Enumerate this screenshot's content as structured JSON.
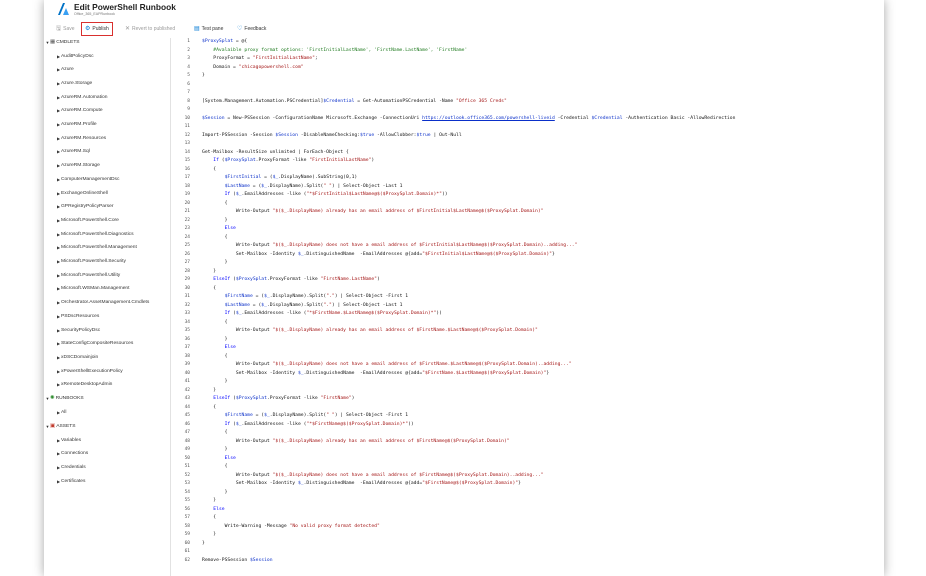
{
  "header": {
    "title": "Edit PowerShell Runbook",
    "subtitle": "Office_365_EAPRunbook"
  },
  "toolbar": {
    "save": "Save",
    "publish": "Publish",
    "revert": "Revert to published",
    "test_pane": "Test pane",
    "feedback": "Feedback"
  },
  "tree": {
    "cmdlets_label": "CMDLETS",
    "modules": [
      "AuditPolicyDsc",
      "Azure",
      "Azure.Storage",
      "AzureRM.Automation",
      "AzureRM.Compute",
      "AzureRM.Profile",
      "AzureRM.Resources",
      "AzureRM.Sql",
      "AzureRM.Storage",
      "ComputerManagementDsc",
      "ExchangeOnlineShell",
      "GPRegistryPolicyParser",
      "Microsoft.PowerShell.Core",
      "Microsoft.PowerShell.Diagnostics",
      "Microsoft.PowerShell.Management",
      "Microsoft.PowerShell.Security",
      "Microsoft.PowerShell.Utility",
      "Microsoft.WSMan.Management",
      "Orchestrator.AssetManagement.Cmdlets",
      "PSDscResources",
      "SecurityPolicyDsc",
      "StateConfigCompositeResources",
      "xDSCDomainjoin",
      "xPowerShellExecutionPolicy",
      "xRemoteDesktopAdmin"
    ],
    "runbooks_label": "RUNBOOKS",
    "runbooks": [
      "All"
    ],
    "assets_label": "ASSETS",
    "assets": [
      "Variables",
      "Connections",
      "Credentials",
      "Certificates"
    ]
  },
  "colors": {
    "accent": "#0078d4",
    "highlight": "#d9302e",
    "variable": "#0a2fc9",
    "string": "#a31515",
    "comment": "#1e7a1e"
  },
  "code_lines": [
    "$ProxySplat = @{",
    "    #Avalaible proxy format options: 'FirstInitialLastName', 'FirstName.LastName', 'FirstName'",
    "    ProxyFormat = \"FirstInitialLastName\";",
    "    Domain = \"chicagopowershell.com\"",
    "}",
    "",
    "",
    "[System.Management.Automation.PSCredential]$Credential = Get-AutomationPSCredential -Name \"Office 365 Creds\"",
    "",
    "$Session = New-PSSession -ConfigurationName Microsoft.Exchange -ConnectionUri https://outlook.office365.com/powershell-liveid -Credential $Credential -Authentication Basic -AllowRedirection",
    "",
    "Import-PSSession -Session $Session -DisableNameChecking:$true -AllowClobber:$true | Out-Null",
    "",
    "Get-Mailbox -ResultSize unlimited | ForEach-Object {",
    "    If ($ProxySplat.ProxyFormat -like \"FirstInitialLastName\")",
    "    {",
    "        $FirstInitial = ($_.DisplayName).SubString(0,1)",
    "        $LastName = ($_.DisplayName).Split(\" \") | Select-Object -Last 1",
    "        If ($_.EmailAddresses -like (\"*$FirstInitial$LastName@$($ProxySplat.Domain)*\"))",
    "        {",
    "            Write-Output \"$($_.DisplayName) already has an email address of $FirstInitial$LastName@$($ProxySplat.Domain)\"",
    "        }",
    "        Else",
    "        {",
    "            Write-Output \"$($_.DisplayName) does not have a email address of $FirstInitial$LastName@$($ProxySplat.Domain)..adding...\"",
    "            Set-Mailbox -Identity $_.DistinguishedName  -EmailAddresses @{add=\"$FirstInitial$LastName@$($ProxySplat.Domain)\"}",
    "        }",
    "    }",
    "    ElseIf ($ProxySplat.ProxyFormat -like \"FirstName.LastName\")",
    "    {",
    "        $FirstName = ($_.DisplayName).Split(\".\") | Select-Object -First 1",
    "        $LastName = ($_.DisplayName).Split(\".\") | Select-Object -Last 1",
    "        If ($_.EmailAddresses -like (\"*$FirstName.$LastName@$($ProxySplat.Domain)*\"))",
    "        {",
    "            Write-Output \"$($_.DisplayName) already has an email address of $FirstName.$LastName@$($ProxySplat.Domain)\"",
    "        }",
    "        Else",
    "        {",
    "            Write-Output \"$($_.DisplayName) does not have a email address of $FirstName.$LastName@$($ProxySplat.Domain)..adding...\"",
    "            Set-Mailbox -Identity $_.DistinguishedName  -EmailAddresses @{add=\"$FirstName.$LastName@$($ProxySplat.Domain)\"}",
    "        }",
    "    }",
    "    ElseIf ($ProxySplat.ProxyFormat -like \"FirstName\")",
    "    {",
    "        $FirstName = ($_.DisplayName).Split(\" \") | Select-Object -First 1",
    "        If ($_.EmailAddresses -like (\"*$FirstName@$($ProxySplat.Domain)*\"))",
    "        {",
    "            Write-Output \"$($_.DisplayName) already has an email address of $FirstName@$($ProxySplat.Domain)\"",
    "        }",
    "        Else",
    "        {",
    "            Write-Output \"$($_.DisplayName) does not have a email address of $FirstName@$($ProxySplat.Domain)..adding...\"",
    "            Set-Mailbox -Identity $_.DistinguishedName  -EmailAddresses @{add=\"$FirstName@$($ProxySplat.Domain)\"}",
    "        }",
    "    }",
    "    Else",
    "    {",
    "        Write-Warning -Message \"No valid proxy format detected\"",
    "    }",
    "}",
    "",
    "Remove-PSSession $Session"
  ]
}
